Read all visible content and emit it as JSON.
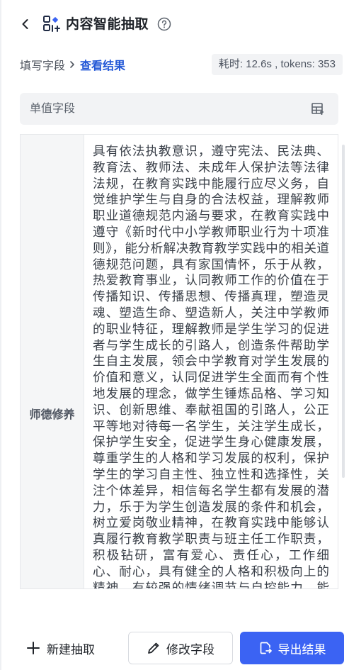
{
  "header": {
    "title": "内容智能抽取"
  },
  "breadcrumb": {
    "step1": "填写字段",
    "step2": "查看结果"
  },
  "stats": {
    "text": "耗时: 12.6s , tokens: 353"
  },
  "field_bar": {
    "label": "单值字段"
  },
  "result": {
    "field_name": "师德修养",
    "value": "具有依法执教意识，遵守宪法、民法典、教育法、教师法、未成年人保护法等法律法规，在教育实践中能履行应尽义务，自觉维护学生与自身的合法权益，理解教师职业道德规范内涵与要求，在教育实践中遵守《新时代中小学教师职业行为十项准则》，能分析解决教育教学实践中的相关道德规范问题，具有家国情怀，乐于从教，热爱教育事业，认同教师工作的价值在于传播知识、传播思想、传播真理，塑造灵魂、塑造生命、塑造新人，关注中学教师的职业特征，理解教师是学生学习的促进者与学生成长的引路人，创造条件帮助学生自主发展，领会中学教育对学生发展的价值和意义，认同促进学生全面而有个性地发展的理念，做学生锤炼品格、学习知识、创新思维、奉献祖国的引路人，公正平等地对待每一名学生，关注学生成长，保护学生安全，促进学生身心健康发展，尊重学生的人格和学习发展的权利，保护学生的学习自主性、独立性和选择性，关注个体差异，相信每名学生都有发展的潜力，乐于为学生创造发展的条件和机会，树立爱岗敬业精神，在教育实践中能够认真履行教育教学职责与班主任工作职责，积极钻研，富有爱心、责任心，工作细心、耐心，具有健全的人格和积极向上的精神，有较强的情绪调节与自控能力，能积极应变，比较"
  },
  "footer": {
    "new_label": "新建抽取",
    "edit_label": "修改字段",
    "export_label": "导出结果"
  },
  "colors": {
    "accent": "#3b63f3",
    "link": "#2257d6"
  },
  "icons": {
    "back": "chevron-left-icon",
    "app": "scan-grid-icon",
    "help": "question-circle-icon",
    "separator": "chevron-right-icon",
    "field_bar": "table-icon",
    "new": "plus-icon",
    "edit": "pencil-icon",
    "export": "export-file-icon"
  }
}
